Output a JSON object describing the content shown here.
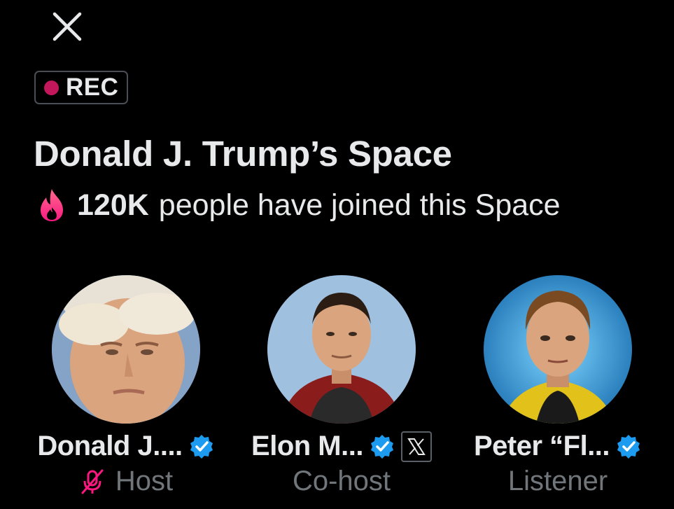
{
  "rec_badge": {
    "label": "REC",
    "dot_color": "#c2185b"
  },
  "space": {
    "title": "Donald J. Trump’s Space",
    "joined_count": "120K",
    "joined_text": "people have joined this Space"
  },
  "participants": [
    {
      "name": "Donald J....",
      "role": "Host",
      "verified": true,
      "muted": true
    },
    {
      "name": "Elon M...",
      "role": "Co-host",
      "verified": true,
      "affiliate_badge": "x-logo"
    },
    {
      "name": "Peter “Fl...",
      "role": "Listener",
      "verified": true
    }
  ],
  "colors": {
    "background": "#000000",
    "primary_text": "#e7e9ea",
    "secondary_text": "#71767b",
    "verified_blue": "#1d9bf0",
    "accent_pink": "#f91880"
  }
}
